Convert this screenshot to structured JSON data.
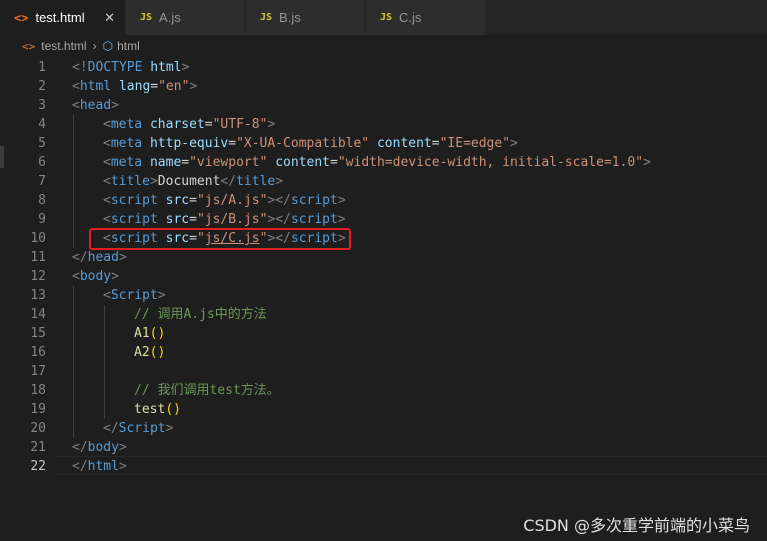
{
  "tabs": [
    {
      "icon": "<>",
      "label": "test.html",
      "close": "✕",
      "type": "html"
    },
    {
      "icon": "JS",
      "label": "A.js",
      "type": "js"
    },
    {
      "icon": "JS",
      "label": "B.js",
      "type": "js"
    },
    {
      "icon": "JS",
      "label": "C.js",
      "type": "js"
    }
  ],
  "breadcrumb": {
    "file_icon": "<>",
    "file": "test.html",
    "sep": "›",
    "node": "html"
  },
  "lines": {
    "l1": {
      "num": "1",
      "t1": "<!",
      "n": "DOCTYPE",
      "sp": " ",
      "txt": "html",
      "t2": ">"
    },
    "l2": {
      "num": "2",
      "t1": "<",
      "n": "html",
      "sp": " ",
      "a": "lang",
      "eq": "=",
      "s": "\"en\"",
      "t2": ">"
    },
    "l3": {
      "num": "3",
      "t1": "<",
      "n": "head",
      "t2": ">"
    },
    "l4": {
      "num": "4",
      "t1": "<",
      "n": "meta",
      "sp": " ",
      "a": "charset",
      "eq": "=",
      "s": "\"UTF-8\"",
      "t2": ">"
    },
    "l5": {
      "num": "5",
      "t1": "<",
      "n": "meta",
      "sp": " ",
      "a": "http-equiv",
      "eq": "=",
      "s": "\"X-UA-Compatible\"",
      "sp2": " ",
      "a2": "content",
      "eq2": "=",
      "s2": "\"IE=edge\"",
      "t2": ">"
    },
    "l6": {
      "num": "6",
      "t1": "<",
      "n": "meta",
      "sp": " ",
      "a": "name",
      "eq": "=",
      "s": "\"viewport\"",
      "sp2": " ",
      "a2": "content",
      "eq2": "=",
      "s2": "\"width=device-width, initial-scale=1.0\"",
      "t2": ">"
    },
    "l7": {
      "num": "7",
      "t1": "<",
      "n": "title",
      "t2": ">",
      "txt": "Document",
      "t3": "</",
      "n2": "title",
      "t4": ">"
    },
    "l8": {
      "num": "8",
      "t1": "<",
      "n": "script",
      "sp": " ",
      "a": "src",
      "eq": "=",
      "q1": "\"",
      "s": "js/A.js",
      "q2": "\"",
      "t2": "></",
      "n2": "script",
      "t3": ">"
    },
    "l9": {
      "num": "9",
      "t1": "<",
      "n": "script",
      "sp": " ",
      "a": "src",
      "eq": "=",
      "q1": "\"",
      "s": "js/B.js",
      "q2": "\"",
      "t2": "></",
      "n2": "script",
      "t3": ">"
    },
    "l10": {
      "num": "10",
      "t1": "<",
      "n": "script",
      "sp": " ",
      "a": "src",
      "eq": "=",
      "q1": "\"",
      "s": "js/C.js",
      "q2": "\"",
      "t2": "></",
      "n2": "script",
      "t3": ">"
    },
    "l11": {
      "num": "11",
      "t1": "</",
      "n": "head",
      "t2": ">"
    },
    "l12": {
      "num": "12",
      "t1": "<",
      "n": "body",
      "t2": ">"
    },
    "l13": {
      "num": "13",
      "t1": "<",
      "n": "Script",
      "t2": ">"
    },
    "l14": {
      "num": "14",
      "c": "// 调用A.js中的方法"
    },
    "l15": {
      "num": "15",
      "f": "A1",
      "p": "()"
    },
    "l16": {
      "num": "16",
      "f": "A2",
      "p": "()"
    },
    "l17": {
      "num": "17"
    },
    "l18": {
      "num": "18",
      "c": "// 我们调用test方法。"
    },
    "l19": {
      "num": "19",
      "f": "test",
      "p": "()"
    },
    "l20": {
      "num": "20",
      "t1": "</",
      "n": "Script",
      "t2": ">"
    },
    "l21": {
      "num": "21",
      "t1": "</",
      "n": "body",
      "t2": ">"
    },
    "l22": {
      "num": "22",
      "t1": "</",
      "n": "html",
      "t2": ">"
    }
  },
  "watermark": "CSDN @多次重学前端的小菜鸟",
  "colors": {
    "highlight_box": "#e02020",
    "background": "#1e1e1e"
  }
}
